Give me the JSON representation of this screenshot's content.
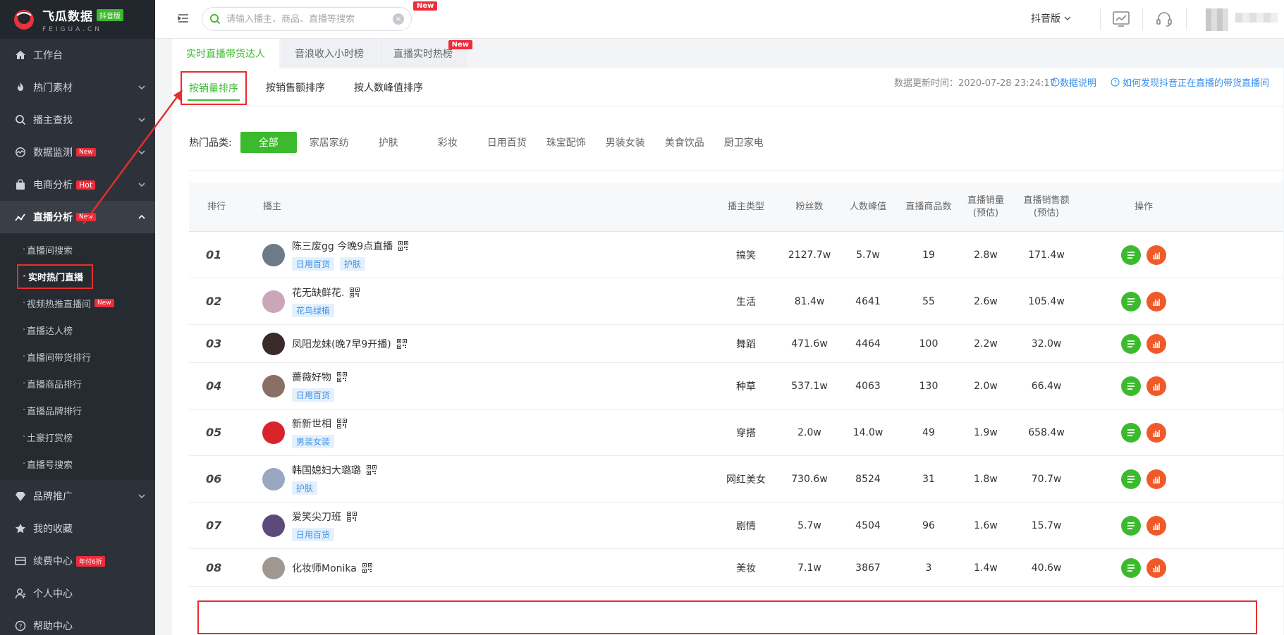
{
  "brand": {
    "title": "飞瓜数据",
    "badge": "抖音版",
    "subtitle": "FEIGUA.CN"
  },
  "sidebar": {
    "items": [
      {
        "label": "工作台",
        "icon": "home-icon"
      },
      {
        "label": "热门素材",
        "icon": "fire-icon",
        "chevron": "down"
      },
      {
        "label": "播主查找",
        "icon": "search-icon",
        "chevron": "down"
      },
      {
        "label": "数据监测",
        "icon": "monitor-icon",
        "tag": "New",
        "chevron": "down"
      },
      {
        "label": "电商分析",
        "icon": "bag-icon",
        "tag": "Hot",
        "chevron": "down"
      },
      {
        "label": "直播分析",
        "icon": "live-chart-icon",
        "tag": "New",
        "chevron": "up",
        "active": true
      }
    ],
    "sub_items": [
      {
        "label": "直播间搜索"
      },
      {
        "label": "实时热门直播",
        "active": true
      },
      {
        "label": "视频热推直播间",
        "tag": "New"
      },
      {
        "label": "直播达人榜"
      },
      {
        "label": "直播间带货排行"
      },
      {
        "label": "直播商品排行"
      },
      {
        "label": "直播品牌排行"
      },
      {
        "label": "土豪打赏榜"
      },
      {
        "label": "直播号搜索"
      }
    ],
    "items_after": [
      {
        "label": "品牌推广",
        "icon": "diamond-icon",
        "chevron": "down"
      },
      {
        "label": "我的收藏",
        "icon": "star-icon"
      },
      {
        "label": "续费中心",
        "icon": "card-icon",
        "tag": "年付6折"
      },
      {
        "label": "个人中心",
        "icon": "user-icon"
      },
      {
        "label": "帮助中心",
        "icon": "help-icon"
      }
    ]
  },
  "topbar": {
    "search_placeholder": "请输入播主、商品、直播等搜索",
    "search_new_badge": "New",
    "version": "抖音版"
  },
  "top_tabs": [
    {
      "label": "实时直播带货达人",
      "active": true
    },
    {
      "label": "音浪收入小时榜"
    },
    {
      "label": "直播实时热榜",
      "badge": "New"
    }
  ],
  "sort_tabs": [
    {
      "label": "按销量排序",
      "active": true
    },
    {
      "label": "按销售额排序"
    },
    {
      "label": "按人数峰值排序"
    }
  ],
  "update_time": "数据更新时间：2020-07-28 23:24:17",
  "help_links": [
    "数据说明",
    "如何发现抖音正在直播的带货直播间"
  ],
  "categories": {
    "label": "热门品类:",
    "items": [
      "全部",
      "家居家纺",
      "护肤",
      "彩妆",
      "日用百货",
      "珠宝配饰",
      "男装女装",
      "美食饮品",
      "厨卫家电"
    ]
  },
  "table": {
    "columns": {
      "rank": "排行",
      "anchor": "播主",
      "type": "播主类型",
      "fans": "粉丝数",
      "peak": "人数峰值",
      "goods": "直播商品数",
      "sales_1": "直播销量",
      "sales_2": "(预估)",
      "amount_1": "直播销售额",
      "amount_2": "(预估)",
      "ops": "操作"
    },
    "rows": [
      {
        "rank": "01",
        "name": "陈三废gg 今晚9点直播",
        "tags": [
          "日用百货",
          "护肤"
        ],
        "type": "搞笑",
        "fans": "2127.7w",
        "peak": "5.7w",
        "goods": "19",
        "sales": "2.8w",
        "amount": "171.4w",
        "avatar": "#6d7a88"
      },
      {
        "rank": "02",
        "name": "花无缺鲜花.",
        "tags": [
          "花鸟绿植"
        ],
        "type": "生活",
        "fans": "81.4w",
        "peak": "4641",
        "goods": "55",
        "sales": "2.6w",
        "amount": "105.4w",
        "avatar": "#c9a6b8"
      },
      {
        "rank": "03",
        "name": "凤阳龙妹(晚7早9开播)",
        "tags": [],
        "type": "舞蹈",
        "fans": "471.6w",
        "peak": "4464",
        "goods": "100",
        "sales": "2.2w",
        "amount": "32.0w",
        "avatar": "#3a2a2a"
      },
      {
        "rank": "04",
        "name": "蔷薇好物",
        "tags": [
          "日用百货"
        ],
        "type": "种草",
        "fans": "537.1w",
        "peak": "4063",
        "goods": "130",
        "sales": "2.0w",
        "amount": "66.4w",
        "avatar": "#8a6f66"
      },
      {
        "rank": "05",
        "name": "新新世相",
        "tags": [
          "男装女装"
        ],
        "type": "穿搭",
        "fans": "2.0w",
        "peak": "14.0w",
        "goods": "49",
        "sales": "1.9w",
        "amount": "658.4w",
        "avatar": "#d8232a"
      },
      {
        "rank": "06",
        "name": "韩国媳妇大璐璐",
        "tags": [
          "护肤"
        ],
        "type": "网红美女",
        "fans": "730.6w",
        "peak": "8524",
        "goods": "31",
        "sales": "1.8w",
        "amount": "70.7w",
        "avatar": "#9aa7c0"
      },
      {
        "rank": "07",
        "name": "爱笑尖刀班",
        "tags": [
          "日用百货"
        ],
        "type": "剧情",
        "fans": "5.7w",
        "peak": "4504",
        "goods": "96",
        "sales": "1.6w",
        "amount": "15.7w",
        "avatar": "#5b4a7a"
      },
      {
        "rank": "08",
        "name": "化妆师Monika",
        "tags": [],
        "type": "美妆",
        "fans": "7.1w",
        "peak": "3867",
        "goods": "3",
        "sales": "1.4w",
        "amount": "40.6w",
        "avatar": "#a09890"
      }
    ]
  },
  "colors": {
    "accent": "#3cba2e",
    "link": "#3b8fe8",
    "highlight": "#e62e2e",
    "sidebar_bg": "#2d323a"
  }
}
